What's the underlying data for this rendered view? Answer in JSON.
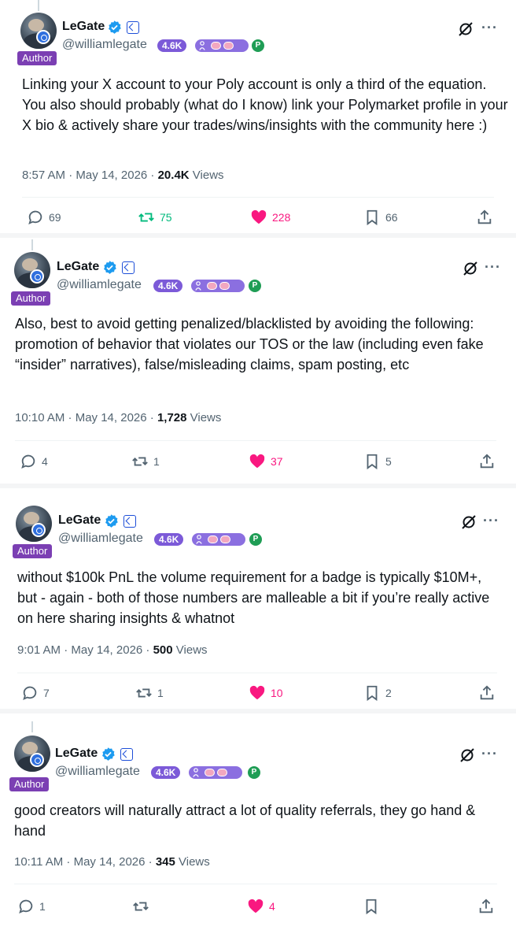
{
  "posts": [
    {
      "author": {
        "name": "LeGate",
        "handle": "@williamlegate",
        "tag": "Author",
        "follower_badge": "4.6K",
        "badge_icons": [
          "person-icon",
          "brain-icon",
          "brain-icon",
          "polymarket-icon"
        ]
      },
      "text": "Linking your X account to your Poly account is only a third of the equation. You also should probably (what do I know) link your Polymarket profile in your X bio & actively share your trades/wins/insights with the community here :)",
      "time": "8:57 AM · May 14, 2026 · ",
      "views_count": "20.4K",
      "views_label": " Views",
      "replies": "69",
      "reposts": "75",
      "likes": "228",
      "bookmarks": "66",
      "reposted": true
    },
    {
      "author": {
        "name": "LeGate",
        "handle": "@williamlegate",
        "tag": "Author",
        "follower_badge": "4.6K",
        "badge_icons": [
          "person-icon",
          "brain-icon",
          "brain-icon",
          "polymarket-icon"
        ]
      },
      "text": "Also, best to avoid getting penalized/blacklisted by avoiding the following: promotion of behavior that violates our TOS or the law (including even fake “insider” narratives), false/misleading claims, spam posting, etc",
      "time": "10:10 AM · May 14, 2026 · ",
      "views_count": "1,728",
      "views_label": " Views",
      "replies": "4",
      "reposts": "1",
      "likes": "37",
      "bookmarks": "5",
      "reposted": false
    },
    {
      "author": {
        "name": "LeGate",
        "handle": "@williamlegate",
        "tag": "Author",
        "follower_badge": "4.6K",
        "badge_icons": [
          "person-icon",
          "brain-icon",
          "brain-icon",
          "polymarket-icon"
        ]
      },
      "text": "without $100k PnL the volume requirement for a badge is typically $10M+, but - again - both of those numbers are malleable a bit if you’re really active on here sharing insights & whatnot",
      "time": "9:01 AM · May 14, 2026 · ",
      "views_count": "500",
      "views_label": " Views",
      "replies": "7",
      "reposts": "1",
      "likes": "10",
      "bookmarks": "2",
      "reposted": false
    },
    {
      "author": {
        "name": "LeGate",
        "handle": "@williamlegate",
        "tag": "Author",
        "follower_badge": "4.6K",
        "badge_icons": [
          "person-icon",
          "brain-icon",
          "brain-icon",
          "polymarket-icon"
        ]
      },
      "text": "good creators will naturally attract a lot of quality referrals, they go hand & hand",
      "time": "10:11 AM · May 14, 2026 · ",
      "views_count": "345",
      "views_label": " Views",
      "replies": "1",
      "reposts": "",
      "likes": "4",
      "bookmarks": "",
      "reposted": false
    }
  ],
  "colors": {
    "like": "#f91880",
    "repost_active": "#00ba7c",
    "verified": "#1d9bf0",
    "author_tag": "#7b3fb3",
    "muted": "#536471"
  }
}
